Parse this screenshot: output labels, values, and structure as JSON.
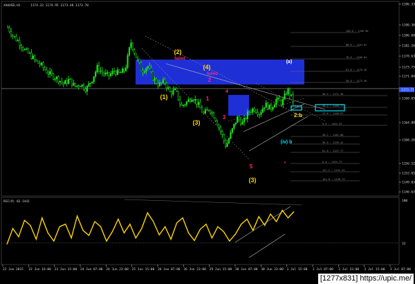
{
  "header": {
    "symbol_info": "XAUUSD,H1",
    "ohlc": "1174.32 1174.95 1173.48 1173.70"
  },
  "price_axis": {
    "ticks": [
      "1196.33",
      "1190.30",
      "1186.68",
      "1182.28",
      "1178.63",
      "1173.75",
      "1171.04",
      "1168.65",
      "1164.88",
      "1160.26",
      "1156.52",
      "1152.65",
      "1149.03",
      "1146.63"
    ],
    "current_price": "1173.75",
    "current_color": "#3355ff"
  },
  "rsi_axis": {
    "ticks": [
      "100",
      "32"
    ],
    "label": "RSI(9) 82.1441"
  },
  "time_axis": {
    "ticks": [
      "22 Jun 2015",
      "22 Jun 16:00",
      "23 Jun 15:00",
      "24 Jun 07:00",
      "24 Jun 23:00",
      "25 Jun 15:00",
      "26 Jun 07:00",
      "26 Jun 23:00",
      "29 Jun 15:00",
      "30 Jun 07:00",
      "30 Jun 23:00",
      "1 Jul 15:00",
      "2 Jul 07:00",
      "2 Jul 23:00",
      "3 Jul 15:00",
      "3 Jul 07:00"
    ]
  },
  "fib_levels": [
    {
      "label": "100.0 : 1186.90"
    },
    {
      "label": "88.6 : 1184.62"
    },
    {
      "label": "78.6 : 1180.84"
    },
    {
      "label": "61.8 : 1176.46"
    },
    {
      "label": "50.0 : 1173.46"
    },
    {
      "label": "38.2 : 1171.90"
    },
    {
      "label": "38.2 : 1168.77"
    },
    {
      "label": "23.6 : 1166.87"
    },
    {
      "label": "0.0 : 1164.23"
    },
    {
      "label": "38.2 : 1161.08"
    },
    {
      "label": "50.0 : 1159.42"
    },
    {
      "label": "61.8 : 1157.77"
    },
    {
      "label": "0.0 : 1155.73"
    },
    {
      "label": "127.2 : 1151.33"
    },
    {
      "label": "161.8 : 1148.73"
    }
  ],
  "wave_labels": [
    {
      "text": "(2)",
      "color": "#ffd700"
    },
    {
      "text": "(4)",
      "color": "#ffd700"
    },
    {
      "text": "(1)",
      "color": "#ffd700"
    },
    {
      "text": "(3)",
      "color": "#ffd700"
    },
    {
      "text": "(3)",
      "color": "#ffd700"
    },
    {
      "text": "(a)",
      "color": "#ffffff"
    },
    {
      "text": "2",
      "color": "#ff2a7a"
    },
    {
      "text": "1",
      "color": "#ff2a7a"
    },
    {
      "text": "3",
      "color": "#ff2a7a"
    },
    {
      "text": "4",
      "color": "#ff2a7a"
    },
    {
      "text": "5",
      "color": "#ff2a7a"
    },
    {
      "text": "2:b",
      "color": "#ffd700"
    },
    {
      "text": "(iv) b",
      "color": "#00e5ff"
    },
    {
      "text": "c",
      "color": "#ff2a7a"
    },
    {
      "text": "failed",
      "color": "#ff2a7a"
    },
    {
      "text": "failed",
      "color": "#ff2a7a"
    }
  ],
  "footer": {
    "text": "[1277x831] https://upic.me/"
  },
  "colors": {
    "candle": "#1de01d",
    "rsi": "#ffd700",
    "zone": "#1f2fd6",
    "fib": "#6e6e6e",
    "cyan_box": "#00e5ff"
  },
  "chart_data": [
    {
      "type": "candlestick",
      "title": "XAUUSD,H1",
      "ylim": [
        1145,
        1197
      ],
      "close_path": [
        1190.5,
        1188.0,
        1186.5,
        1184.2,
        1183.0,
        1181.2,
        1180.1,
        1178.3,
        1177.2,
        1176.4,
        1175.0,
        1176.2,
        1174.3,
        1175.0,
        1173.6,
        1176.0,
        1179.5,
        1178.0,
        1177.2,
        1178.5,
        1177.8,
        1179.0,
        1186.5,
        1182.2,
        1178.5,
        1180.0,
        1176.5,
        1174.8,
        1175.7,
        1172.6,
        1173.3,
        1168.8,
        1170.1,
        1171.6,
        1169.5,
        1166.8,
        1168.3,
        1166.0,
        1162.3,
        1158.0,
        1162.0,
        1165.8,
        1164.2,
        1167.3,
        1168.4,
        1167.0,
        1169.5,
        1168.3,
        1170.8,
        1169.8,
        1173.5,
        1170.5
      ]
    },
    {
      "type": "line",
      "title": "RSI(9) 82.1441",
      "ylim": [
        0,
        100
      ],
      "series": [
        {
          "values": [
            30,
            55,
            42,
            68,
            60,
            38,
            72,
            48,
            35,
            58,
            62,
            40,
            75,
            52,
            44,
            66,
            58,
            35,
            50,
            70,
            48,
            62,
            40,
            55,
            80,
            66,
            45,
            58,
            38,
            64,
            72,
            48,
            36,
            54,
            62,
            40,
            58,
            50,
            35,
            46,
            62,
            70,
            52,
            74,
            60,
            78,
            66,
            84,
            72,
            82
          ]
        }
      ]
    }
  ]
}
